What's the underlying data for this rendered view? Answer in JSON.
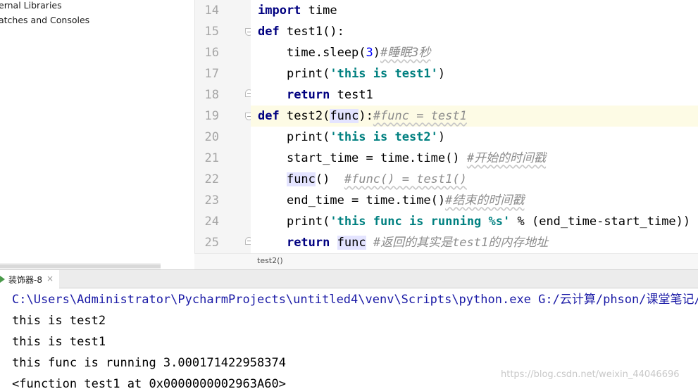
{
  "project_tree": {
    "items": [
      "ernal Libraries",
      "atches and Consoles"
    ]
  },
  "editor": {
    "line_numbers": [
      "14",
      "15",
      "16",
      "17",
      "18",
      "19",
      "20",
      "21",
      "22",
      "23",
      "24",
      "25"
    ],
    "lines": [
      {
        "t1": "import",
        "t2": " time"
      },
      {
        "t1": "def",
        "t2": " test1():"
      },
      {
        "t1": "    time.sleep(",
        "t2": "3",
        "t3": ")",
        "t4": "#睡眠3秒"
      },
      {
        "t1": "    print(",
        "t2": "'this is test1'",
        "t3": ")"
      },
      {
        "t1": "    ",
        "t2": "return",
        "t3": " test1"
      },
      {
        "t1": "def",
        "t2": " test2(",
        "t3": "func",
        "t4": "):",
        "t5": "#func = test1"
      },
      {
        "t1": "    print(",
        "t2": "'this is test2'",
        "t3": ")"
      },
      {
        "t1": "    start_time = time.time() ",
        "t2": "#开始的时间戳"
      },
      {
        "t1": "    ",
        "t2": "func",
        "t3": "()  ",
        "t4": "#func() = test1()"
      },
      {
        "t1": "    end_time = time.time()",
        "t2": "#结束的时间戳"
      },
      {
        "t1": "    print(",
        "t2": "'this func is running ",
        "t3": "%s",
        "t4": "'",
        "t5": " % (end_time-start_time))"
      },
      {
        "t1": "    ",
        "t2": "return",
        "t3": " ",
        "t4": "func",
        "t5": " ",
        "t6": "#返回的其实是test1的内存地址"
      }
    ],
    "breadcrumb": "test2()"
  },
  "run_panel": {
    "tab_label": "装饰器-8",
    "close_glyph": "×",
    "console_lines": [
      "C:\\Users\\Administrator\\PycharmProjects\\untitled4\\venv\\Scripts\\python.exe G:/云计算/phson/课堂笔记/",
      "this is test2",
      "this is test1",
      "this func is running 3.000171422958374",
      "<function test1 at 0x0000000002963A60>"
    ]
  },
  "watermark": "https://blog.csdn.net/weixin_44046696",
  "colors": {
    "keyword": "#000080",
    "string": "#008080",
    "number": "#0000ff",
    "comment": "#8c8c8c",
    "current_line": "#fdfbe5",
    "console_path": "#1a1aa6"
  }
}
